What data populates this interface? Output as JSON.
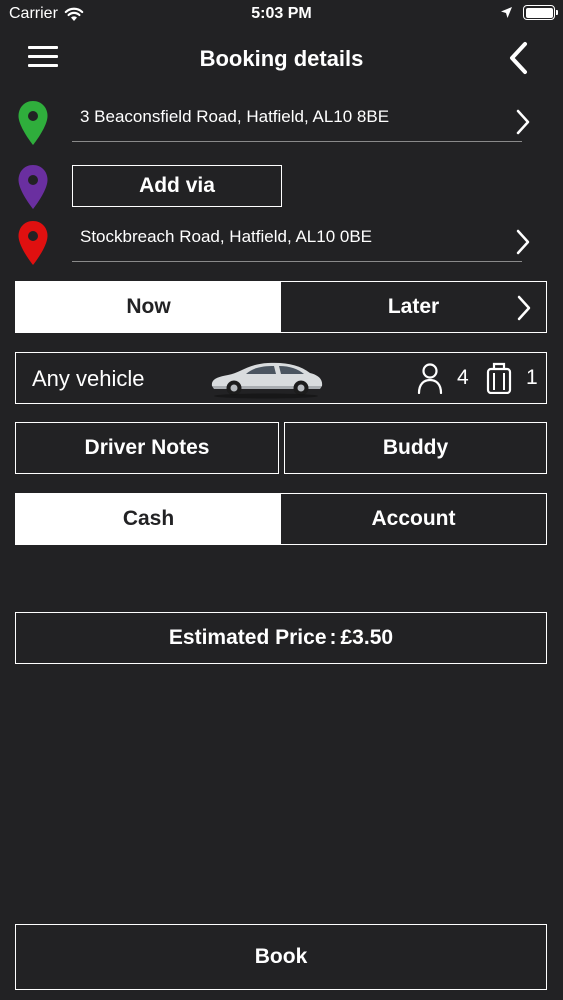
{
  "status_bar": {
    "carrier": "Carrier",
    "time": "5:03 PM"
  },
  "nav": {
    "title": "Booking details",
    "menu_icon": "hamburger-menu-icon",
    "back_icon": "chevron-left-icon"
  },
  "route": {
    "pickup": {
      "address": "3 Beaconsfield Road, Hatfield, AL10 8BE",
      "pin_color": "#2fae3c"
    },
    "via": {
      "button_label": "Add via",
      "pin_color": "#6a2fa0"
    },
    "dropoff": {
      "address": "Stockbreach Road, Hatfield, AL10 0BE",
      "pin_color": "#e01010"
    }
  },
  "timing": {
    "now_label": "Now",
    "later_label": "Later",
    "selected": "now"
  },
  "vehicle": {
    "label": "Any vehicle",
    "passengers": "4",
    "luggage": "1"
  },
  "extras": {
    "driver_notes_label": "Driver Notes",
    "buddy_label": "Buddy"
  },
  "payment": {
    "cash_label": "Cash",
    "account_label": "Account",
    "selected": "cash"
  },
  "price": {
    "label": "Estimated Price",
    "separator": ":",
    "value": "£3.50"
  },
  "book": {
    "label": "Book"
  },
  "colors": {
    "background": "#222224",
    "foreground": "#ffffff"
  }
}
